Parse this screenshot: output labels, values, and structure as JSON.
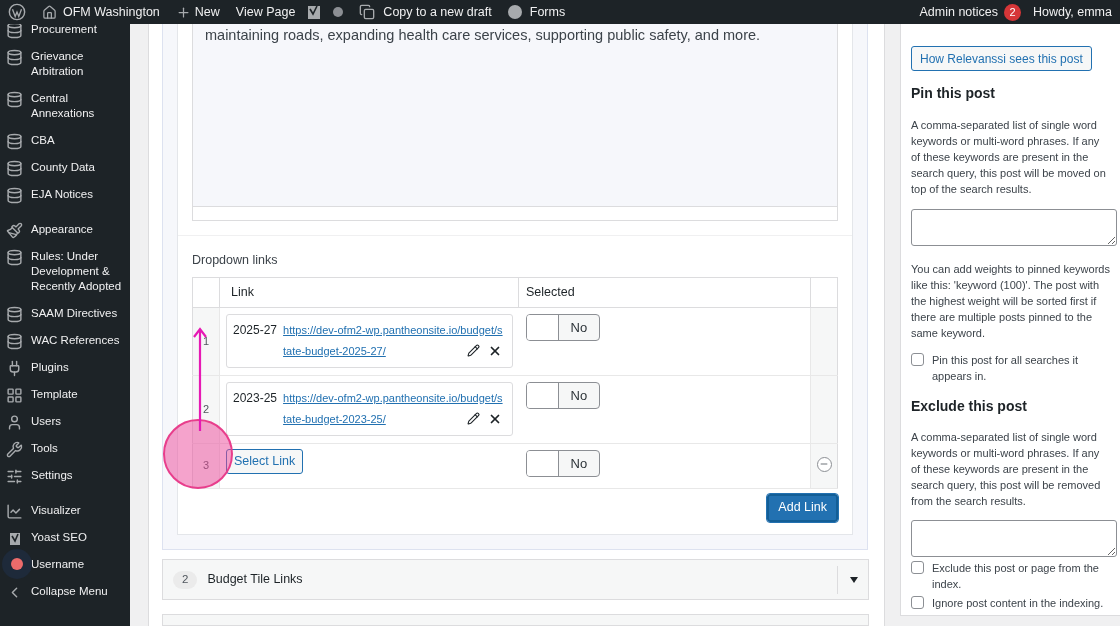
{
  "admin_bar": {
    "site": "OFM Washington",
    "new": "New",
    "view_page": "View Page",
    "copy_draft": "Copy to a new draft",
    "forms": "Forms",
    "notices": "Admin notices",
    "notice_count": "2",
    "greeting": "Howdy, emma"
  },
  "sidebar": {
    "groups": [
      {
        "items": [
          {
            "label": "Procurement"
          },
          {
            "label": "Grievance Arbitration"
          },
          {
            "label": "Central Annexations"
          },
          {
            "label": "CBA"
          },
          {
            "label": "County Data"
          },
          {
            "label": "EJA Notices"
          }
        ]
      },
      {
        "items": [
          {
            "label": "Appearance"
          },
          {
            "label": "Rules: Under Development & Recently Adopted"
          },
          {
            "label": "SAAM Directives"
          },
          {
            "label": "WAC References"
          },
          {
            "label": "Plugins"
          },
          {
            "label": "Template"
          },
          {
            "label": "Users"
          },
          {
            "label": "Tools"
          },
          {
            "label": "Settings"
          }
        ]
      },
      {
        "items": [
          {
            "label": "Visualizer"
          },
          {
            "label": "Yoast SEO"
          },
          {
            "label": "Username"
          },
          {
            "label": "Collapse Menu"
          }
        ]
      }
    ]
  },
  "editor": {
    "text": "maintaining roads, expanding health care services, supporting public safety, and more."
  },
  "dropdown_links": {
    "title": "Dropdown links",
    "columns": [
      "Link",
      "Selected"
    ],
    "rows": [
      {
        "number": "1",
        "year": "2025-27",
        "url": "https://dev-ofm2-wp.pantheonsite.io/budget/state-budget-2025-27/",
        "toggle_label": "No",
        "on": false,
        "kind": "link"
      },
      {
        "number": "2",
        "year": "2023-25",
        "url": "https://dev-ofm2-wp.pantheonsite.io/budget/state-budget-2023-25/",
        "toggle_label": "No",
        "on": false,
        "kind": "link"
      },
      {
        "number": "3",
        "select_label": "Select Link",
        "toggle_label": "No",
        "on": false,
        "kind": "empty"
      }
    ],
    "add_button": "Add Link"
  },
  "section": {
    "count": "2",
    "title": "Budget Tile Links"
  },
  "relevanssi": {
    "button": "How Relevanssi sees this post",
    "pin_title": "Pin this post",
    "pin_text": "A comma-separated list of single word keywords or multi-word phrases. If any of these keywords are present in the search query, this post will be moved on top of the search results.",
    "weights_text": "You can add weights to pinned keywords like this: 'keyword (100)'. The post with the highest weight will be sorted first if there are multiple posts pinned to the same keyword.",
    "pin_all": {
      "label": "Pin this post for all searches it appears in.",
      "checked": false
    },
    "exclude_title": "Exclude this post",
    "exclude_text": "A comma-separated list of single word keywords or multi-word phrases. If any of these keywords are present in the search query, this post will be removed from the search results.",
    "options": [
      {
        "label": "Exclude this post or page from the index.",
        "checked": false
      },
      {
        "label": "Ignore post content in the indexing.",
        "checked": false
      }
    ]
  }
}
